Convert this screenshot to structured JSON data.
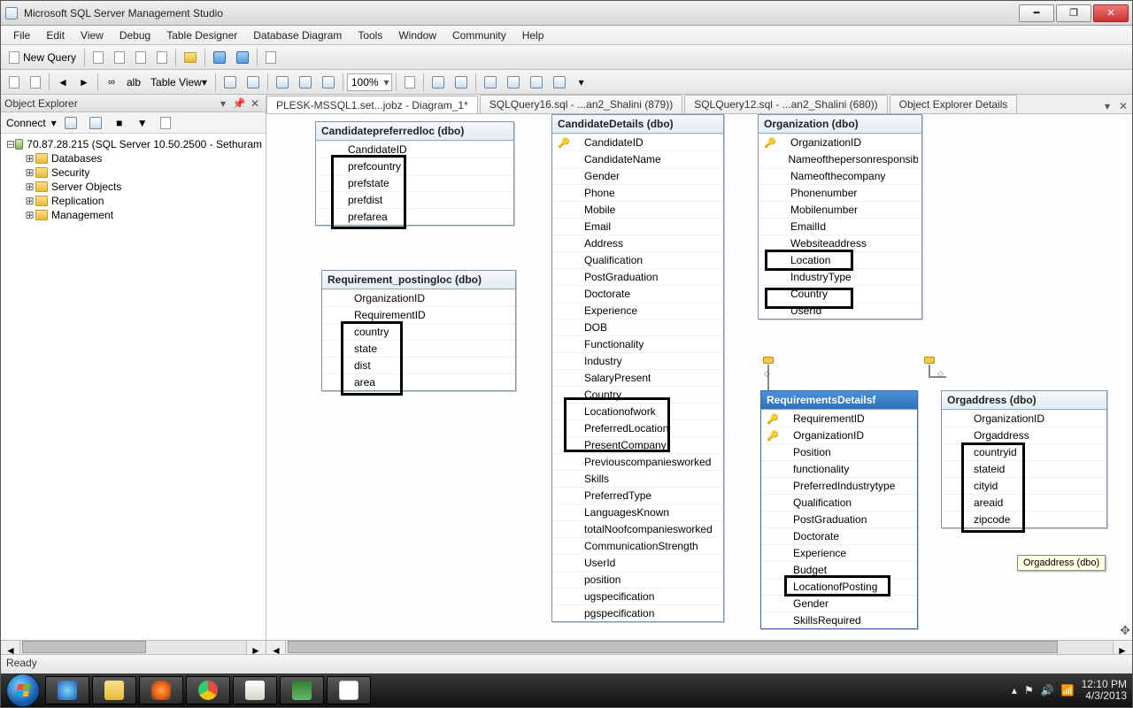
{
  "window": {
    "title": "Microsoft SQL Server Management Studio"
  },
  "menubar": [
    "File",
    "Edit",
    "View",
    "Debug",
    "Table Designer",
    "Database Diagram",
    "Tools",
    "Window",
    "Community",
    "Help"
  ],
  "toolbar1": {
    "new_query": "New Query"
  },
  "toolbar2": {
    "table_view": "Table View",
    "zoom": "100%"
  },
  "object_explorer": {
    "title": "Object Explorer",
    "connect": "Connect",
    "root": "70.87.28.215 (SQL Server 10.50.2500 - Sethuram",
    "nodes": [
      "Databases",
      "Security",
      "Server Objects",
      "Replication",
      "Management"
    ]
  },
  "tabs": [
    {
      "label": "PLESK-MSSQL1.set...jobz - Diagram_1*",
      "active": true
    },
    {
      "label": "SQLQuery16.sql - ...an2_Shalini (879))",
      "active": false
    },
    {
      "label": "SQLQuery12.sql - ...an2_Shalini (680))",
      "active": false
    },
    {
      "label": "Object Explorer Details",
      "active": false
    }
  ],
  "tables": {
    "candidatepreferredloc": {
      "title": "Candidatepreferredloc (dbo)",
      "cols": [
        {
          "n": "CandidateID",
          "pk": false
        },
        {
          "n": "prefcountry"
        },
        {
          "n": "prefstate"
        },
        {
          "n": "prefdist"
        },
        {
          "n": "prefarea"
        }
      ]
    },
    "requirement_postingloc": {
      "title": "Requirement_postingloc (dbo)",
      "cols": [
        {
          "n": "OrganizationID"
        },
        {
          "n": "RequirementID"
        },
        {
          "n": "country"
        },
        {
          "n": "state"
        },
        {
          "n": "dist"
        },
        {
          "n": "area"
        }
      ]
    },
    "candidatedetails": {
      "title": "CandidateDetails (dbo)",
      "cols": [
        {
          "n": "CandidateID",
          "pk": true
        },
        {
          "n": "CandidateName"
        },
        {
          "n": "Gender"
        },
        {
          "n": "Phone"
        },
        {
          "n": "Mobile"
        },
        {
          "n": "Email"
        },
        {
          "n": "Address"
        },
        {
          "n": "Qualification"
        },
        {
          "n": "PostGraduation"
        },
        {
          "n": "Doctorate"
        },
        {
          "n": "Experience"
        },
        {
          "n": "DOB"
        },
        {
          "n": "Functionality"
        },
        {
          "n": "Industry"
        },
        {
          "n": "SalaryPresent"
        },
        {
          "n": "Country"
        },
        {
          "n": "Locationofwork"
        },
        {
          "n": "PreferredLocation"
        },
        {
          "n": "PresentCompany"
        },
        {
          "n": "Previouscompaniesworked"
        },
        {
          "n": "Skills"
        },
        {
          "n": "PreferredType"
        },
        {
          "n": "LanguagesKnown"
        },
        {
          "n": "totalNoofcompaniesworked"
        },
        {
          "n": "CommunicationStrength"
        },
        {
          "n": "UserId"
        },
        {
          "n": "position"
        },
        {
          "n": "ugspecification"
        },
        {
          "n": "pgspecification"
        }
      ]
    },
    "organization": {
      "title": "Organization (dbo)",
      "cols": [
        {
          "n": "OrganizationID",
          "pk": true
        },
        {
          "n": "Nameofthepersonresponsibl..."
        },
        {
          "n": "Nameofthecompany"
        },
        {
          "n": "Phonenumber"
        },
        {
          "n": "Mobilenumber"
        },
        {
          "n": "EmailId"
        },
        {
          "n": "Websiteaddress"
        },
        {
          "n": "Location"
        },
        {
          "n": "IndustryType"
        },
        {
          "n": "Country"
        },
        {
          "n": "UserId"
        }
      ]
    },
    "requirementsdetails": {
      "title": "RequirementsDetailsf",
      "cols": [
        {
          "n": "RequirementID",
          "pk": true
        },
        {
          "n": "OrganizationID",
          "pk": true
        },
        {
          "n": "Position"
        },
        {
          "n": "functionality"
        },
        {
          "n": "PreferredIndustrytype"
        },
        {
          "n": "Qualification"
        },
        {
          "n": "PostGraduation"
        },
        {
          "n": "Doctorate"
        },
        {
          "n": "Experience"
        },
        {
          "n": "Budget"
        },
        {
          "n": "LocationofPosting"
        },
        {
          "n": "Gender"
        },
        {
          "n": "SkillsRequired"
        }
      ]
    },
    "orgaddress": {
      "title": "Orgaddress (dbo)",
      "cols": [
        {
          "n": "OrganizationID"
        },
        {
          "n": "Orgaddress"
        },
        {
          "n": "countryid"
        },
        {
          "n": "stateid"
        },
        {
          "n": "cityid"
        },
        {
          "n": "areaid"
        },
        {
          "n": "zipcode"
        }
      ]
    }
  },
  "tooltip": "Orgaddress (dbo)",
  "status": "Ready",
  "tray": {
    "time": "12:10 PM",
    "date": "4/3/2013"
  },
  "labels": {
    "alb": "alb"
  }
}
